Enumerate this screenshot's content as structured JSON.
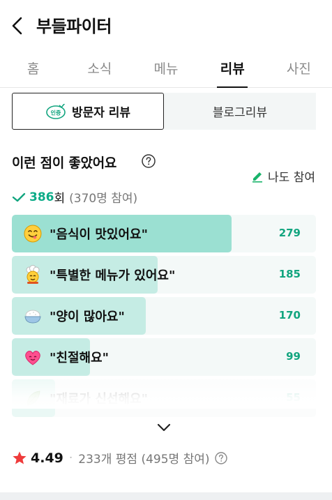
{
  "header": {
    "title": "부들파이터"
  },
  "tabs": [
    {
      "label": "홈",
      "active": false
    },
    {
      "label": "소식",
      "active": false
    },
    {
      "label": "메뉴",
      "active": false
    },
    {
      "label": "리뷰",
      "active": true
    },
    {
      "label": "사진",
      "active": false
    }
  ],
  "review_type": {
    "visitor": {
      "badge": "인증",
      "label": "방문자 리뷰",
      "selected": true
    },
    "blog": {
      "label": "블로그리뷰",
      "selected": false
    }
  },
  "keywords": {
    "title": "이런 점이 좋았어요",
    "write_label": "나도 참여",
    "count": "386",
    "count_unit": "회",
    "participants": "(370명 참여)",
    "max_value": 279,
    "items": [
      {
        "label": "\"음식이 맛있어요\"",
        "value": 279,
        "icon": "yum-face-icon"
      },
      {
        "label": "\"특별한 메뉴가 있어요\"",
        "value": 185,
        "icon": "chef-icon"
      },
      {
        "label": "\"양이 많아요\"",
        "value": 170,
        "icon": "rice-bowl-icon"
      },
      {
        "label": "\"친절해요\"",
        "value": 99,
        "icon": "heart-icon"
      },
      {
        "label": "\"재료가 신선해요\"",
        "value": 55,
        "icon": "leaf-icon"
      }
    ]
  },
  "rating": {
    "score": "4.49",
    "reviews_text": "233개 평점 (495명 참여)"
  },
  "colors": {
    "accent_green": "#12a57f",
    "bar_fill_top": "#9be0d2",
    "bar_fill": "#c5ece4",
    "star_red": "#ef3b3b"
  }
}
